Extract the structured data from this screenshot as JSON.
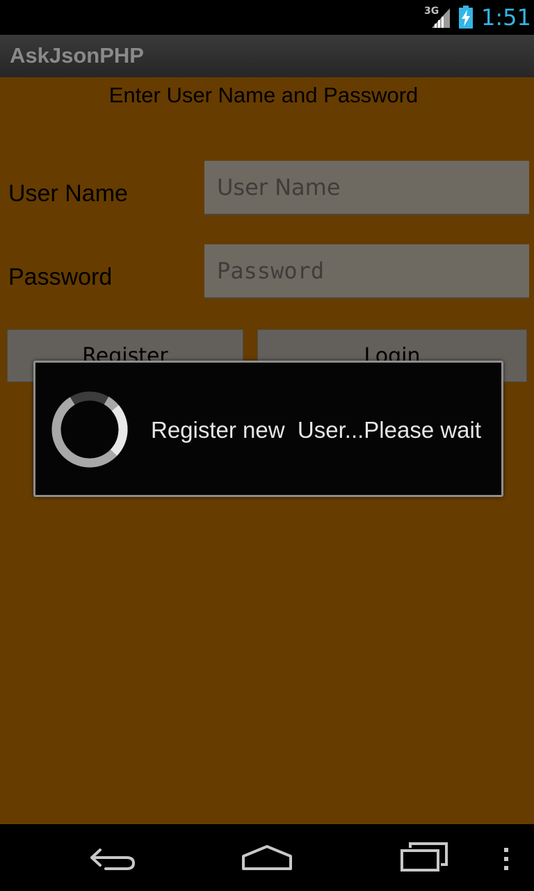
{
  "status_bar": {
    "network": "3G",
    "time": "1:51",
    "accent_color": "#33b5e5"
  },
  "action_bar": {
    "title": "AskJsonPHP"
  },
  "form": {
    "prompt": "Enter User Name and Password",
    "username_label": "User Name",
    "username_placeholder": "User Name",
    "username_value": "",
    "password_label": "Password",
    "password_placeholder": "Password",
    "password_value": "",
    "register_label": "Register",
    "login_label": "Login",
    "background_color": "#663c00"
  },
  "dialog": {
    "message": "Register new  User...Please wait",
    "icon": "spinner-icon"
  },
  "nav_bar": {
    "icons": [
      "back-icon",
      "home-icon",
      "recents-icon",
      "menu-icon"
    ]
  }
}
